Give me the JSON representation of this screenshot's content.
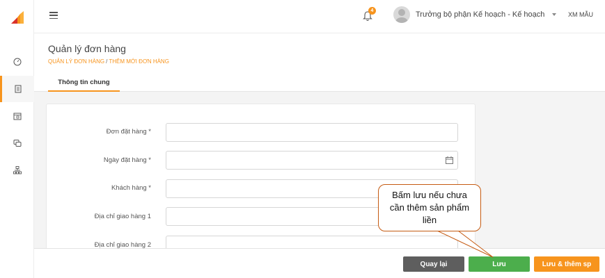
{
  "header": {
    "notification_count": "4",
    "username": "Trưởng bộ phận Kế hoạch - Kế hoạch",
    "company": "XM MẪU"
  },
  "sidebar": {
    "items": [
      {
        "icon": "dashboard-icon"
      },
      {
        "icon": "document-icon",
        "active": true
      },
      {
        "icon": "calendar-icon"
      },
      {
        "icon": "chat-icon"
      },
      {
        "icon": "sitemap-icon"
      }
    ]
  },
  "page": {
    "title": "Quản lý đơn hàng",
    "breadcrumb": [
      "QUẢN LÝ ĐƠN HÀNG",
      "/",
      "THÊM MỚI ĐƠN HÀNG"
    ],
    "tab": "Thông tin chung"
  },
  "form": {
    "fields": [
      {
        "label": "Đơn đặt hàng *",
        "value": ""
      },
      {
        "label": "Ngày đặt hàng *",
        "value": ""
      },
      {
        "label": "Khách hàng *",
        "value": ""
      },
      {
        "label": "Địa chỉ giao hàng 1",
        "value": ""
      },
      {
        "label": "Địa chỉ giao hàng 2",
        "value": ""
      }
    ]
  },
  "actions": {
    "back": "Quay lại",
    "save": "Lưu",
    "save_add": "Lưu & thêm sp"
  },
  "callout": {
    "text": "Bấm lưu nếu chưa cần thêm sản phẩm liền"
  },
  "colors": {
    "accent": "#f7941d",
    "save": "#4cae4c",
    "back": "#5e5e5e",
    "callout_border": "#c55a11"
  }
}
